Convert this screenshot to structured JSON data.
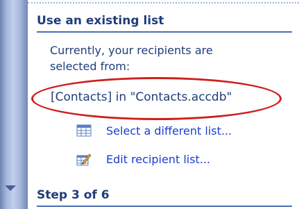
{
  "panel": {
    "section_title": "Use an existing list",
    "description": "Currently, your recipients are selected from:",
    "source": "[Contacts] in \"Contacts.accdb\"",
    "actions": [
      {
        "label": "Select a different list...",
        "icon": "table-list-icon"
      },
      {
        "label": "Edit recipient list...",
        "icon": "edit-list-icon"
      }
    ],
    "step_label": "Step 3 of 6"
  },
  "colors": {
    "heading": "#1f3d7a",
    "link": "#1a3cd0",
    "highlight": "#cf1f1f",
    "rule": "#4a6fb8",
    "scrollbar": "#a4b4da"
  }
}
